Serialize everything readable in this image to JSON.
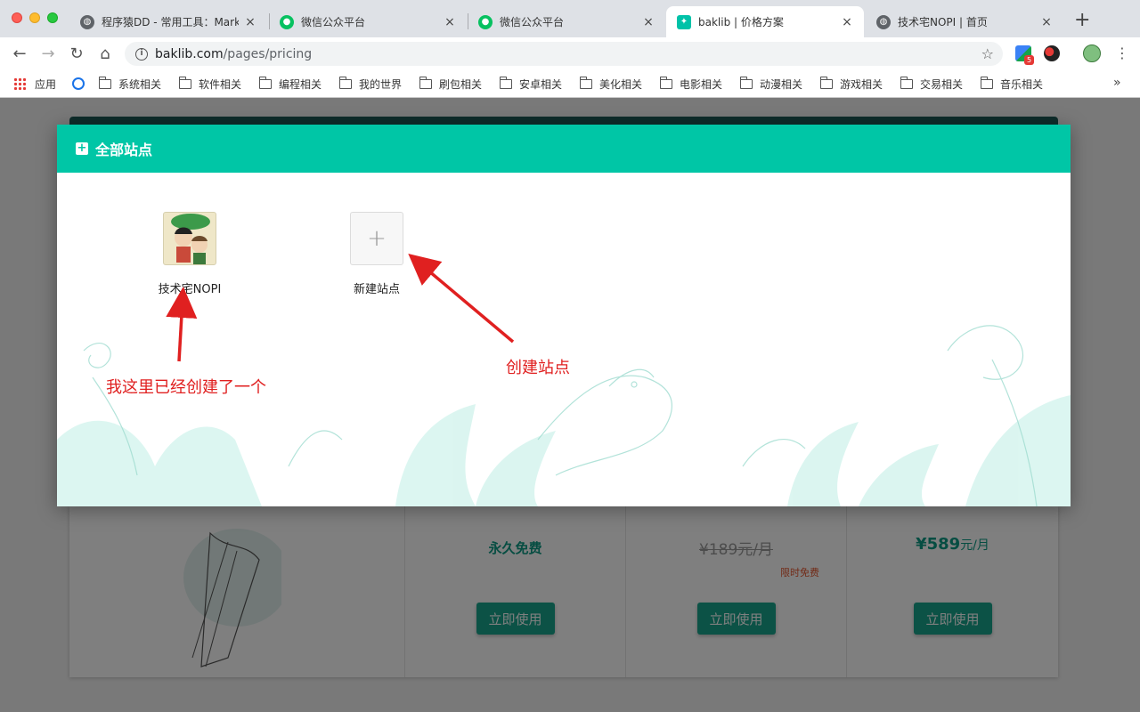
{
  "browser": {
    "tabs": [
      {
        "title": "程序猿DD - 常用工具：Markdown",
        "icon": "globe-icon",
        "close": "×"
      },
      {
        "title": "微信公众平台",
        "icon": "wechat-icon",
        "close": "×"
      },
      {
        "title": "微信公众平台",
        "icon": "wechat-icon",
        "close": "×"
      },
      {
        "title": "baklib | 价格方案",
        "icon": "baklib-icon",
        "close": "×",
        "active": true
      },
      {
        "title": "技术宅NOPI | 首页",
        "icon": "globe-icon",
        "close": "×"
      }
    ],
    "new_tab": "+",
    "url_domain": "baklib.com",
    "url_path": "/pages/pricing",
    "extension_badge": "5",
    "bookmarks": [
      "应用",
      "系统相关",
      "软件相关",
      "编程相关",
      "我的世界",
      "刷包相关",
      "安卓相关",
      "美化相关",
      "电影相关",
      "动漫相关",
      "游戏相关",
      "交易相关",
      "音乐相关"
    ],
    "bookmarks_more": "»"
  },
  "modal": {
    "title": "全部站点",
    "sites": [
      {
        "label": "技术宅NOPI",
        "kind": "avatar"
      },
      {
        "label": "新建站点",
        "kind": "add",
        "glyph": "+"
      }
    ],
    "annotations": {
      "existing": "我这里已经创建了一个",
      "create": "创建站点"
    }
  },
  "pricing": {
    "plans": [
      {
        "price": "永久免费"
      },
      {
        "old_price": "¥189元/月",
        "note": "限时免费"
      },
      {
        "symbol": "¥",
        "amount": "589",
        "unit": "元/月"
      }
    ],
    "button_label": "立即使用"
  },
  "colors": {
    "accent": "#00c6a6",
    "annotation": "#e02020",
    "button": "#18a58c"
  }
}
